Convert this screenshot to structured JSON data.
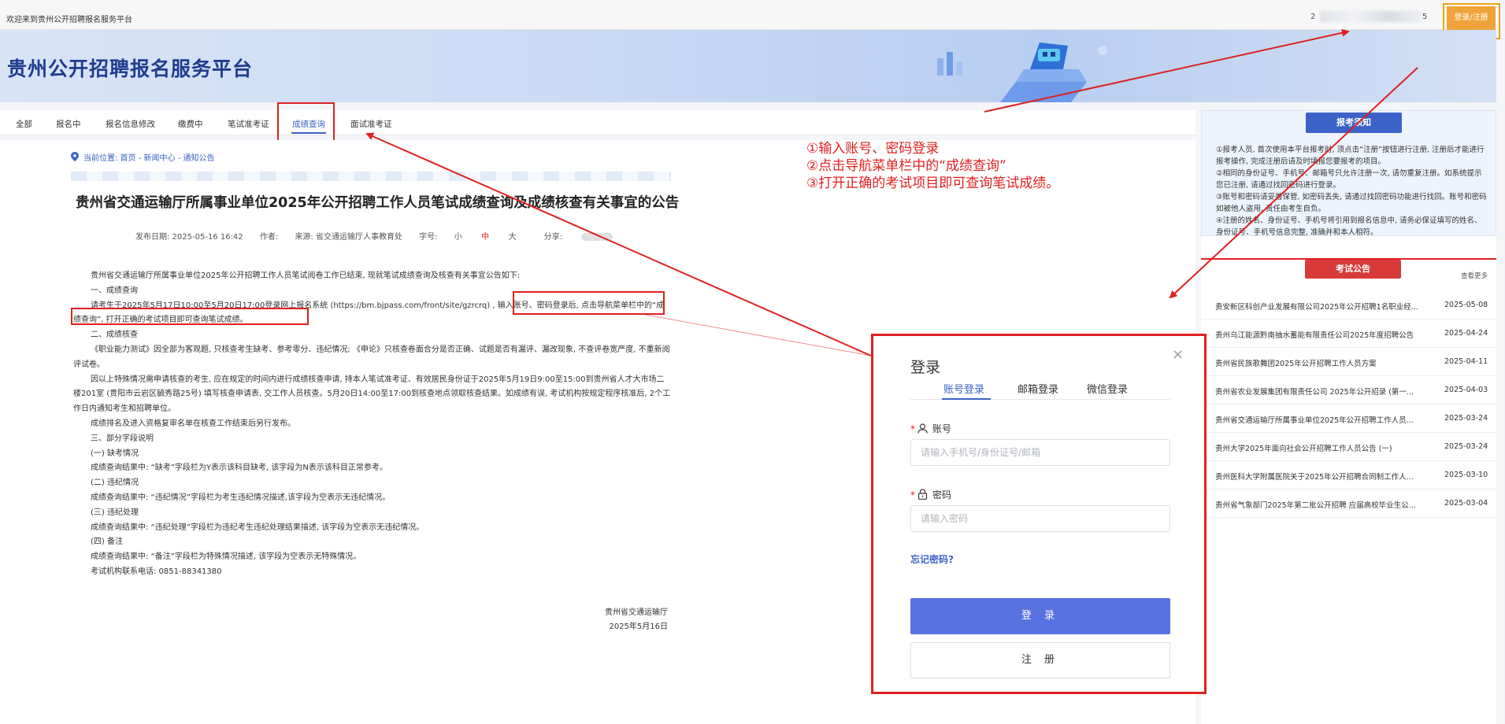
{
  "topbar": {
    "welcome": "欢迎来到贵州公开招聘报名服务平台",
    "user_prefix": "2",
    "user_suffix": "5",
    "login_register": "登录/注册"
  },
  "site": {
    "title": "贵州公开招聘报名服务平台"
  },
  "nav": {
    "items": [
      "全部",
      "报名中",
      "报名信息修改",
      "缴费中",
      "笔试准考证",
      "成绩查询",
      "面试准考证"
    ],
    "active": "成绩查询"
  },
  "article": {
    "breadcrumb": "当前位置: 首页 - 新闻中心 - 通知公告",
    "title": "贵州省交通运输厅所属事业单位2025年公开招聘工作人员笔试成绩查询及成绩核查有关事宜的公告",
    "meta": {
      "publish": "发布日期: 2025-05-16 16:42",
      "author": "作者:",
      "source": "来源: 省交通运输厅人事教育处",
      "font_label": "字号:",
      "font_small": "小",
      "font_mid": "中",
      "font_large": "大",
      "share": "分享:"
    },
    "paragraphs": [
      "贵州省交通运输厅所属事业单位2025年公开招聘工作人员笔试阅卷工作已结束, 现就笔试成绩查询及核查有关事宜公告如下:",
      "一、成绩查询",
      "请考生于2025年5月17日10:00至5月20日17:00登录网上报名系统 (https://bm.bjpass.com/front/site/gzrcrq) , 输入账号、密码登录后, 点击导航菜单栏中的“成绩查询”, 打开正确的考试项目即可查询笔试成绩。",
      "二、成绩核查",
      "《职业能力测试》因全部为客观题, 只核查考生缺考、参考零分、违纪情况; 《申论》只核查卷面合分是否正确、试题是否有漏评、漏改现象, 不查评卷宽严度, 不重新阅评试卷。",
      "因以上特殊情况需申请核查的考生, 应在规定的时间内进行成绩核查申请, 持本人笔试准考证、有效居民身份证于2025年5月19日9:00至15:00到贵州省人才大市场二楼201室 (贵阳市云岩区毓秀路25号) 填写核查申请表, 交工作人员核查。5月20日14:00至17:00到核查地点领取核查结果。如成绩有误, 考试机构按规定程序核准后, 2个工作日内通知考生和招聘单位。",
      "成绩排名及进入资格复审名单在核查工作结束后另行发布。",
      "三、部分字段说明",
      "(一) 缺考情况",
      "成绩查询结果中: “缺考”字段栏为Y表示该科目缺考, 该字段为N表示该科目正常参考。",
      "(二) 违纪情况",
      "成绩查询结果中: “违纪情况”字段栏为考生违纪情况描述,该字段为空表示无违纪情况。",
      "(三) 违纪处理",
      "成绩查询结果中: “违纪处理”字段栏为违纪考生违纪处理结果描述, 该字段为空表示无违纪情况。",
      "(四) 备注",
      "成绩查询结果中: “备注”字段栏为特殊情况描述, 该字段为空表示无特殊情况。",
      "考试机构联系电话: 0851-88341380"
    ],
    "signature": [
      "贵州省交通运输厅",
      "2025年5月16日"
    ]
  },
  "instructions": [
    "①输入账号、密码登录",
    "②点击导航菜单栏中的“成绩查询”",
    "③打开正确的考试项目即可查询笔试成绩。"
  ],
  "sidebar": {
    "guide_title": "报考须知",
    "guide_lines": [
      "①报考人员, 首次使用本平台报考时, 须点击“注册”按钮进行注册, 注册后才能进行报考操作, 完成注册后请及时填报您要报考的项目。",
      "②相同的身份证号、手机号、邮箱号只允许注册一次, 请勿重复注册。如系统提示您已注册, 请通过找回密码进行登录。",
      "③账号和密码请妥善保管, 如密码丢失, 请通过找回密码功能进行找回。账号和密码如被他人盗用, 责任由考生自负。",
      "④注册的姓名、身份证号、手机号将引用到报名信息中, 请务必保证填写的姓名、身份证号、手机号信息完整, 准确并和本人相符。"
    ],
    "notice_title": "考试公告",
    "notice_more": "查看更多",
    "notices": [
      {
        "title": "贵安新区科创产业发展有限公司2025年公开招聘1名职业经...",
        "date": "2025-05-08"
      },
      {
        "title": "贵州乌江能源黔南抽水蓄能有限责任公司2025年度招聘公告",
        "date": "2025-04-24"
      },
      {
        "title": "贵州省民族歌舞团2025年公开招聘工作人员方案",
        "date": "2025-04-11"
      },
      {
        "title": "贵州省农业发展集团有限责任公司 2025年公开招录 (第一...",
        "date": "2025-04-03"
      },
      {
        "title": "贵州省交通运输厅所属事业单位2025年公开招聘工作人员...",
        "date": "2025-03-24"
      },
      {
        "title": "贵州大学2025年面向社会公开招聘工作人员公告 (一)",
        "date": "2025-03-24"
      },
      {
        "title": "贵州医科大学附属医院关于2025年公开招聘合同制工作人...",
        "date": "2025-03-10"
      },
      {
        "title": "贵州省气象部门2025年第二批公开招聘 应届高校毕业生公...",
        "date": "2025-03-04"
      }
    ]
  },
  "login": {
    "title": "登录",
    "close": "×",
    "tabs": [
      "账号登录",
      "邮箱登录",
      "微信登录"
    ],
    "account_label": "账号",
    "account_placeholder": "请输入手机号/身份证号/邮箱",
    "password_label": "密码",
    "password_placeholder": "请输入密码",
    "forgot": "忘记密码?",
    "submit": "登 录",
    "register": "注 册"
  },
  "colors": {
    "accent": "#3b62c6",
    "annotation": "#e02020",
    "login_button": "#5873e0",
    "register_top": "#f0a33a"
  }
}
